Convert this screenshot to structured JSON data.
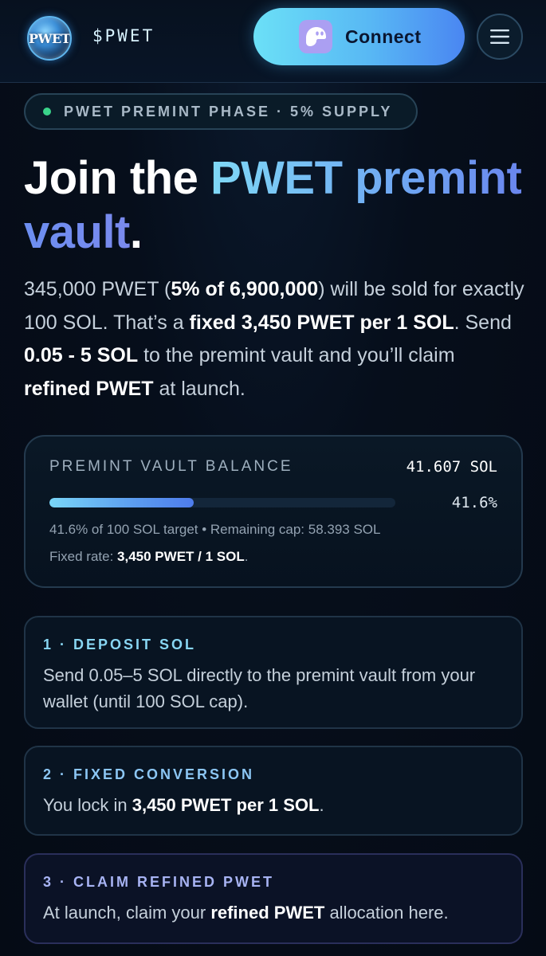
{
  "header": {
    "logo_text": "PWET",
    "ticker": "$PWET",
    "connect_label": "Connect",
    "wallet_icon": "phantom-ghost-icon",
    "menu_icon": "hamburger-menu-icon"
  },
  "phase": {
    "text": "PWET PREMINT PHASE · 5% SUPPLY",
    "status_color": "#3ad38a"
  },
  "headline": {
    "part1": "Join the ",
    "part2": "PWET premint",
    "part3": "vault",
    "part4": "."
  },
  "description": {
    "t1": "345,000 PWET (",
    "b1": "5% of 6,900,000",
    "t2": ") will be sold for exactly 100 SOL. That’s a ",
    "b2": "fixed 3,450 PWET per 1 SOL",
    "t3": ". Send ",
    "b3": "0.05 - 5 SOL",
    "t4": " to the premint vault and you’ll claim ",
    "b4": "refined PWET",
    "t5": " at launch."
  },
  "vault": {
    "label": "PREMINT VAULT BALANCE",
    "balance": "41.607 SOL",
    "percent": "41.6%",
    "progress_fraction": 0.416,
    "sub_text": "41.6% of 100 SOL target • Remaining cap: 58.393 SOL",
    "rate_prefix": "Fixed rate: ",
    "rate_value": "3,450 PWET / 1 SOL",
    "rate_suffix": "."
  },
  "steps": [
    {
      "title": "1 · DEPOSIT SOL",
      "body": "Send 0.05–5 SOL directly to the premint vault from your wallet (until 100 SOL cap)."
    },
    {
      "title": "2 · FIXED CONVERSION",
      "body_prefix": "You lock in ",
      "body_bold": "3,450 PWET per 1 SOL",
      "body_suffix": "."
    },
    {
      "title": "3 · CLAIM REFINED PWET",
      "body_prefix": "At launch, claim your ",
      "body_bold": "refined PWET",
      "body_suffix": " allocation here."
    }
  ],
  "colors": {
    "accent_cyan": "#6be0f7",
    "accent_blue": "#4a86f2",
    "background": "#050d18"
  }
}
